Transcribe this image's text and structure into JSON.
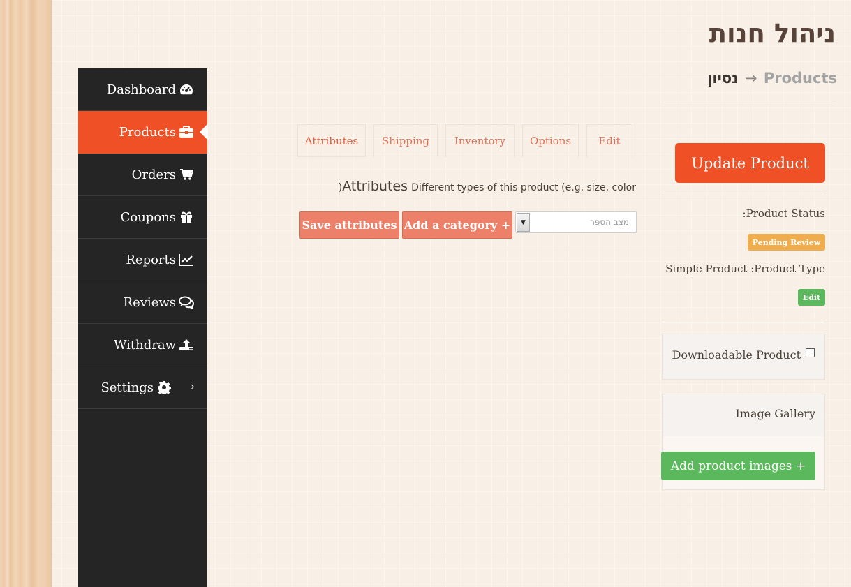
{
  "page": {
    "title": "ניהול חנות"
  },
  "breadcrumb": {
    "link": "Products",
    "arrow": "→",
    "current": "נסיון"
  },
  "sidebar": {
    "items": [
      {
        "label": "Dashboard",
        "icon": "dashboard-icon"
      },
      {
        "label": "Products",
        "icon": "briefcase-icon",
        "active": true
      },
      {
        "label": "Orders",
        "icon": "cart-icon"
      },
      {
        "label": "Coupons",
        "icon": "gift-icon"
      },
      {
        "label": "Reports",
        "icon": "chart-line-icon"
      },
      {
        "label": "Reviews",
        "icon": "comments-icon"
      },
      {
        "label": "Withdraw",
        "icon": "upload-icon"
      },
      {
        "label": "Settings",
        "icon": "gear-icon",
        "chevron": "›"
      }
    ]
  },
  "tabs": {
    "attributes": "Attributes",
    "shipping": "Shipping",
    "inventory": "Inventory",
    "options": "Options",
    "edit": "Edit"
  },
  "attributes_panel": {
    "heading_big": "Attributes",
    "heading_small": "Different types of this product (e.g. size, color",
    "heading_prefix": ")",
    "save_button": "Save attributes",
    "add_category_button": "Add a category +",
    "select_placeholder": "מצב הספר",
    "select_arrow": "▼"
  },
  "product_panel": {
    "update_button": "Update Product",
    "status_label": ":Product Status",
    "status_badge": "Pending Review",
    "type_label": "Simple Product :Product Type",
    "edit_badge": "Edit",
    "downloadable_label": "Downloadable Product",
    "gallery_label": "Image Gallery",
    "add_images_button": "Add product images +"
  },
  "colors": {
    "accent": "#f05025",
    "sidebar_bg": "#252525",
    "pending": "#f0ad4e",
    "success": "#5cb85c",
    "salmon_button": "#ec8069"
  }
}
